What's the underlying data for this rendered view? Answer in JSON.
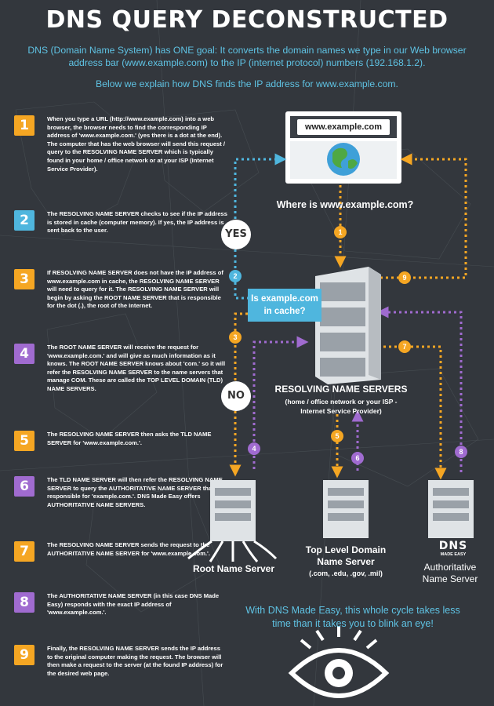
{
  "title": "DNS QUERY DECONSTRUCTED",
  "intro": "DNS (Domain Name System) has ONE goal:  It converts the domain names we type in our Web browser address bar (www.example.com) to the IP (internet protocol) numbers (192.168.1.2).",
  "intro2": "Below we explain how DNS finds the IP address for www.example.com.",
  "colors": {
    "background": "#33373d",
    "orange": "#f5a623",
    "blue": "#4fb6de",
    "purple": "#a06bd0"
  },
  "steps": [
    {
      "num": "1",
      "color": "orange",
      "text": "When you type a URL (http://www.example.com) into a web browser, the browser needs to find the corresponding IP address of  'www.example.com.' (yes there is a dot at the end). The computer that has the web browser will send this request / query to the RESOLVING NAME SERVER which is typically found in your home / office network or at your ISP (Internet Service Provider)."
    },
    {
      "num": "2",
      "color": "blue",
      "text": "The RESOLVING NAME SERVER checks to see if the IP address is stored in cache (computer memory).  If yes, the IP address is sent back to the user."
    },
    {
      "num": "3",
      "color": "orange",
      "text": "If RESOLVING NAME SERVER does not have the IP address of www.example.com in cache, the RESOLVING NAME SERVER will need to query for it.  The RESOLVING NAME SERVER will begin by asking the ROOT NAME SERVER that is responsible for the dot (.), the root of the Internet."
    },
    {
      "num": "4",
      "color": "purple",
      "text": "The ROOT NAME SERVER will receive the request for 'www.example.com.' and will give as much information as it knows.  The ROOT NAME SERVER knows about 'com.' so it will refer the RESOLVING NAME SERVER to the name servers that manage COM. These are called the TOP LEVEL DOMAIN (TLD) NAME SERVERS."
    },
    {
      "num": "5",
      "color": "orange",
      "text": "The RESOLVING NAME SERVER then asks the TLD NAME SERVER for 'www.example.com.'."
    },
    {
      "num": "6",
      "color": "purple",
      "text": "The TLD NAME SERVER will then refer the RESOLVING NAME SERVER to query the AUTHORITATIVE NAME SERVER that is responsible for 'example.com.'. DNS Made Easy offers AUTHORITATIVE NAME SERVERS."
    },
    {
      "num": "7",
      "color": "orange",
      "text": "The RESOLVING NAME SERVER sends the request to the AUTHORITATIVE NAME SERVER for 'www.example.com.'."
    },
    {
      "num": "8",
      "color": "purple",
      "text": "The AUTHORITATIVE NAME SERVER (in this case DNS Made Easy) responds with the exact IP address of 'www.example.com.'."
    },
    {
      "num": "9",
      "color": "orange",
      "text": "Finally, the RESOLVING NAME SERVER sends the IP address to the original computer making the request.  The browser will then make a request to the server (at the found IP address) for the desired web page."
    }
  ],
  "diagram": {
    "browser_url": "www.example.com",
    "where_is": "Where is www.example.com?",
    "cache_question": "Is example.com in cache?",
    "yes": "YES",
    "no": "NO",
    "resolving_title": "RESOLVING NAME SERVERS",
    "resolving_sub": "(home / office network or your ISP - Internet Service Provider)",
    "root_label": "Root Name Server",
    "tld_label": "Top Level Domain Name Server",
    "tld_sub": "(.com, .edu, .gov, .mil)",
    "auth_label": "Authoritative Name Server",
    "logo_text": "DNS",
    "logo_sub": "MADE EASY",
    "cycle": [
      "1",
      "2",
      "3",
      "4",
      "5",
      "6",
      "7",
      "8",
      "9"
    ]
  },
  "finale": "With DNS Made Easy, this whole cycle takes less time than it takes you to blink an eye!"
}
